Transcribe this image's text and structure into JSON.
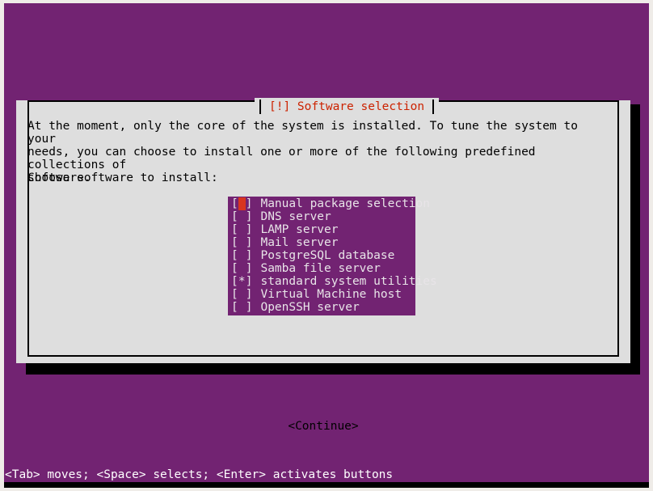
{
  "screen": {
    "background_color": "#722372",
    "frame_color": "#efece8"
  },
  "dialog": {
    "title": "[!] Software selection",
    "title_color": "#cc2200",
    "background_color": "#dedede",
    "body_text": "At the moment, only the core of the system is installed. To tune the system to your\nneeds, you can choose to install one or more of the following predefined collections of\nsoftware.",
    "prompt": "Choose software to install:",
    "continue_label": "<Continue>"
  },
  "selection_list": {
    "highlight_color": "#722372",
    "cursor_color": "#d8351f",
    "items": [
      {
        "checkbox": "[ ]",
        "label": "Manual package selection",
        "checked": false,
        "cursor": true
      },
      {
        "checkbox": "[ ]",
        "label": "DNS server",
        "checked": false,
        "cursor": false
      },
      {
        "checkbox": "[ ]",
        "label": "LAMP server",
        "checked": false,
        "cursor": false
      },
      {
        "checkbox": "[ ]",
        "label": "Mail server",
        "checked": false,
        "cursor": false
      },
      {
        "checkbox": "[ ]",
        "label": "PostgreSQL database",
        "checked": false,
        "cursor": false
      },
      {
        "checkbox": "[ ]",
        "label": "Samba file server",
        "checked": false,
        "cursor": false
      },
      {
        "checkbox": "[*]",
        "label": "standard system utilities",
        "checked": true,
        "cursor": false
      },
      {
        "checkbox": "[ ]",
        "label": "Virtual Machine host",
        "checked": false,
        "cursor": false
      },
      {
        "checkbox": "[ ]",
        "label": "OpenSSH server",
        "checked": false,
        "cursor": false
      }
    ]
  },
  "statusbar": {
    "hint": "<Tab> moves; <Space> selects; <Enter> activates buttons"
  }
}
